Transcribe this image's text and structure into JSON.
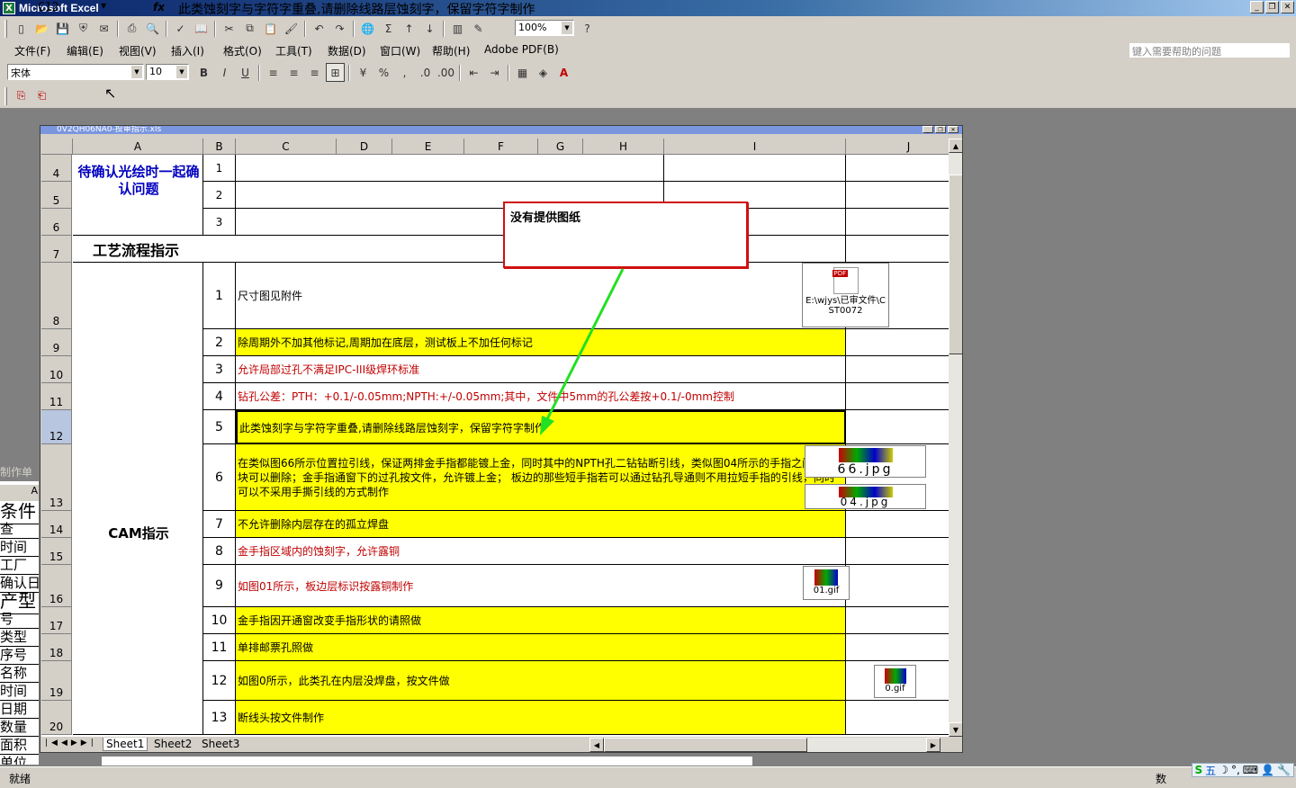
{
  "window": {
    "title": "Microsoft Excel",
    "app_icon": "X"
  },
  "workbook_title": "0V2QH06NA0-投审指示.xls",
  "menu": [
    "文件(F)",
    "编辑(E)",
    "视图(V)",
    "插入(I)",
    "格式(O)",
    "工具(T)",
    "数据(D)",
    "窗口(W)",
    "帮助(H)",
    "Adobe PDF(B)"
  ],
  "help_placeholder": "键入需要帮助的问题",
  "zoom": "100%",
  "font_name": "宋体",
  "font_size": "10",
  "name_box": "C12",
  "formula": "此类蚀刻字与字符字重叠,请删除线路层蚀刻字，保留字符字制作",
  "columns": [
    "A",
    "B",
    "C",
    "D",
    "E",
    "F",
    "G",
    "H",
    "I",
    "J"
  ],
  "rows": [
    "4",
    "5",
    "6",
    "7",
    "8",
    "9",
    "10",
    "11",
    "12",
    "13",
    "14",
    "15",
    "16",
    "17",
    "18",
    "19",
    "20"
  ],
  "labels": {
    "confirm": "待确认光绘时一起确认问题",
    "process": "工艺流程指示",
    "cam": "CAM指示"
  },
  "confirm_items": [
    "1",
    "2",
    "3"
  ],
  "cam_items": [
    {
      "no": "1",
      "text": "尺寸图见附件"
    },
    {
      "no": "2",
      "text": "除周期外不加其他标记,周期加在底层，测试板上不加任何标记"
    },
    {
      "no": "3",
      "text": "允许局部过孔不满足IPC-III级焊环标准"
    },
    {
      "no": "4",
      "text": "钻孔公差：PTH：+0.1/-0.05mm;NPTH:+/-0.05mm;其中，文件中5mm的孔公差按+0.1/-0mm控制"
    },
    {
      "no": "5",
      "text": "此类蚀刻字与字符字重叠,请删除线路层蚀刻字，保留字符字制作"
    },
    {
      "no": "6",
      "text": "在类似图66所示位置拉引线，保证两排金手指都能镀上金，同时其中的NPTH孔二钻钻断引线，类似图04所示的手指之间的铜块可以删除；金手指通窗下的过孔按文件，允许镀上金；  板边的那些短手指若可以通过钻孔导通则不用拉短手指的引线，同时可以不采用手撕引线的方式制作"
    },
    {
      "no": "7",
      "text": "不允许删除内层存在的孤立焊盘"
    },
    {
      "no": "8",
      "text": "金手指区域内的蚀刻字，允许露铜"
    },
    {
      "no": "9",
      "text": "如图01所示，板边层标识按露铜制作"
    },
    {
      "no": "10",
      "text": "金手指因开通窗改变手指形状的请照做"
    },
    {
      "no": "11",
      "text": "单排邮票孔照做"
    },
    {
      "no": "12",
      "text": "如图0所示，此类孔在内层没焊盘，按文件做"
    },
    {
      "no": "13",
      "text": "断线头按文件制作"
    }
  ],
  "attachments": {
    "pdf_label": "E:\\wjys\\已审文件\\CST0072",
    "pdf_badge": "PDF",
    "img66": "66.jpg",
    "img04": "04.jpg",
    "img01": "01.gif",
    "img0": "0.gif"
  },
  "comment": "没有提供图纸",
  "sheets": [
    "Sheet1",
    "Sheet2",
    "Sheet3"
  ],
  "bg_window": {
    "title": "制作单",
    "col": "A",
    "lines": [
      "条件",
      "查",
      "时间",
      "工厂",
      "确认日",
      "产型",
      "号",
      "类型",
      "序号",
      "名称",
      "时间",
      "日期",
      "数量",
      "面积",
      "单位"
    ]
  },
  "status": "就绪",
  "status_right": "数",
  "ime": [
    "S",
    "五",
    "☽",
    "°,",
    "⌨",
    "👤",
    "🔧"
  ],
  "colors": {
    "highlight": "#ffff00",
    "comment_border": "#d01010",
    "arrow": "#22e022",
    "blue_text": "#0000c0",
    "red_text": "#c00000"
  }
}
